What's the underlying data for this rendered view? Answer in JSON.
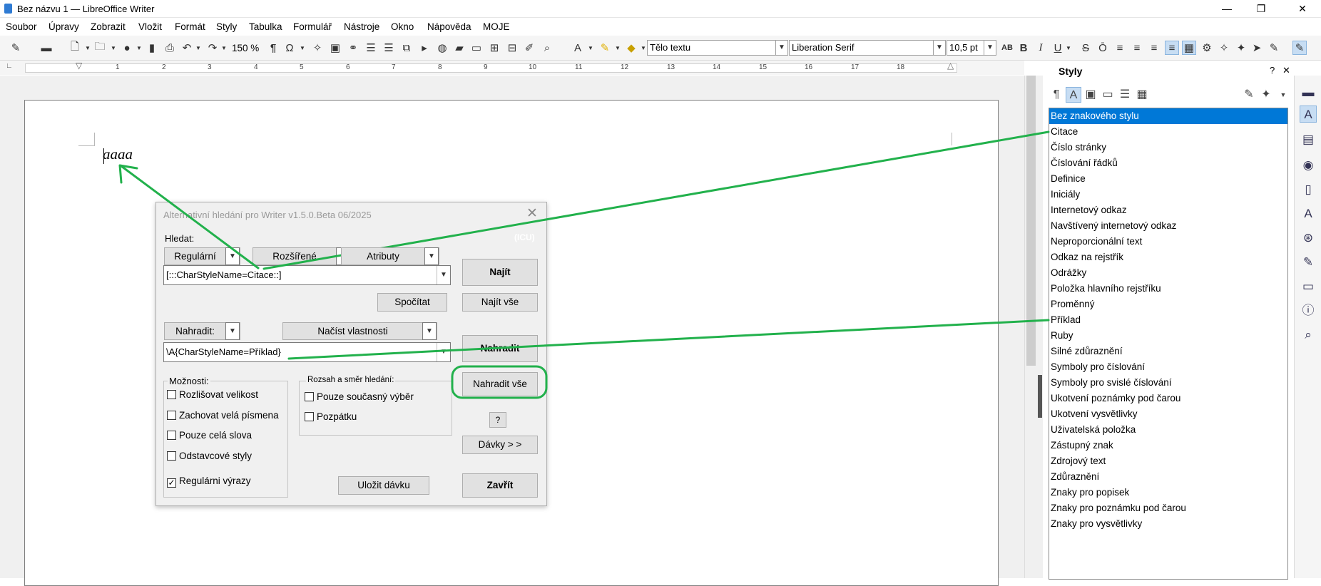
{
  "window": {
    "title": "Bez názvu 1 — LibreOffice Writer",
    "minimize": "—",
    "restore": "❐",
    "close": "✕"
  },
  "menu": [
    "Soubor",
    "Úpravy",
    "Zobrazit",
    "Vložit",
    "Formát",
    "Styly",
    "Tabulka",
    "Formulář",
    "Nástroje",
    "Okno",
    "Nápověda",
    "MOJE"
  ],
  "toolbar": {
    "zoom": "150 %",
    "paragraph_style": "Tělo textu",
    "font_name": "Liberation Serif",
    "font_size": "10,5 pt",
    "bold": "B",
    "italic": "I",
    "underline": "U",
    "strike": "S",
    "pilcrow": "¶",
    "omega": "Ω"
  },
  "ruler": {
    "numbers": [
      "1",
      "2",
      "3",
      "4",
      "5",
      "6",
      "7",
      "8",
      "9",
      "10",
      "11",
      "12",
      "13",
      "14",
      "15",
      "16",
      "17",
      "18"
    ]
  },
  "document": {
    "text": "aaaa"
  },
  "dialog": {
    "title": "Alternativní hledání pro Writer  v1.5.0.Beta  06/2025",
    "close": "✕",
    "icu": "(ICU)",
    "search_label": "Hledat:",
    "mode_regular": "Regulární",
    "mode_extended": "Rozšířené",
    "mode_attributes": "Atributy",
    "search_value": "[:::CharStyleName=Citace::]",
    "find_button": "Najít",
    "count_button": "Spočítat",
    "find_all_button": "Najít vše",
    "replace_label": "Nahradit:",
    "load_properties": "Načíst vlastnosti",
    "replace_value": "\\A{CharStyleName=Příklad}",
    "replace_button": "Nahradit",
    "replace_all_button": "Nahradit vše",
    "options_title": "Možnosti:",
    "options": [
      {
        "label": "Rozlišovat velikost",
        "checked": false
      },
      {
        "label": "Zachovat velá písmena",
        "checked": false
      },
      {
        "label": "Pouze celá slova",
        "checked": false
      },
      {
        "label": "Odstavcové styly",
        "checked": false
      },
      {
        "label": "Regulárni výrazy",
        "checked": true
      }
    ],
    "scope_title": "Rozsah a směr hledání:",
    "scope_options": [
      {
        "label": "Pouze současný výběr",
        "checked": false
      },
      {
        "label": "Pozpátku",
        "checked": false
      }
    ],
    "help_button": "?",
    "batch_button": "Dávky > >",
    "save_batch_button": "Uložit dávku",
    "close_button": "Zavřít"
  },
  "sidebar": {
    "title": "Styly",
    "help": "?",
    "close": "✕",
    "styles": [
      "Bez znakového stylu",
      "Citace",
      "Číslo stránky",
      "Číslování řádků",
      "Definice",
      "Iniciály",
      "Internetový odkaz",
      "Navštívený internetový odkaz",
      "Neproporcionální text",
      "Odkaz na rejstřík",
      "Odrážky",
      "Položka hlavního rejstříku",
      "Proměnný",
      "Příklad",
      "Ruby",
      "Silné zdůraznění",
      "Symboly pro číslování",
      "Symboly pro svislé číslování",
      "Ukotvení poznámky pod čarou",
      "Ukotvení vysvětlivky",
      "Uživatelská položka",
      "Zástupný znak",
      "Zdrojový text",
      "Zdůraznění",
      "Znaky pro popisek",
      "Znaky pro poznámku pod čarou",
      "Znaky pro vysvětlivky"
    ],
    "selected_index": 0
  },
  "annotation_color": "#22b14c"
}
